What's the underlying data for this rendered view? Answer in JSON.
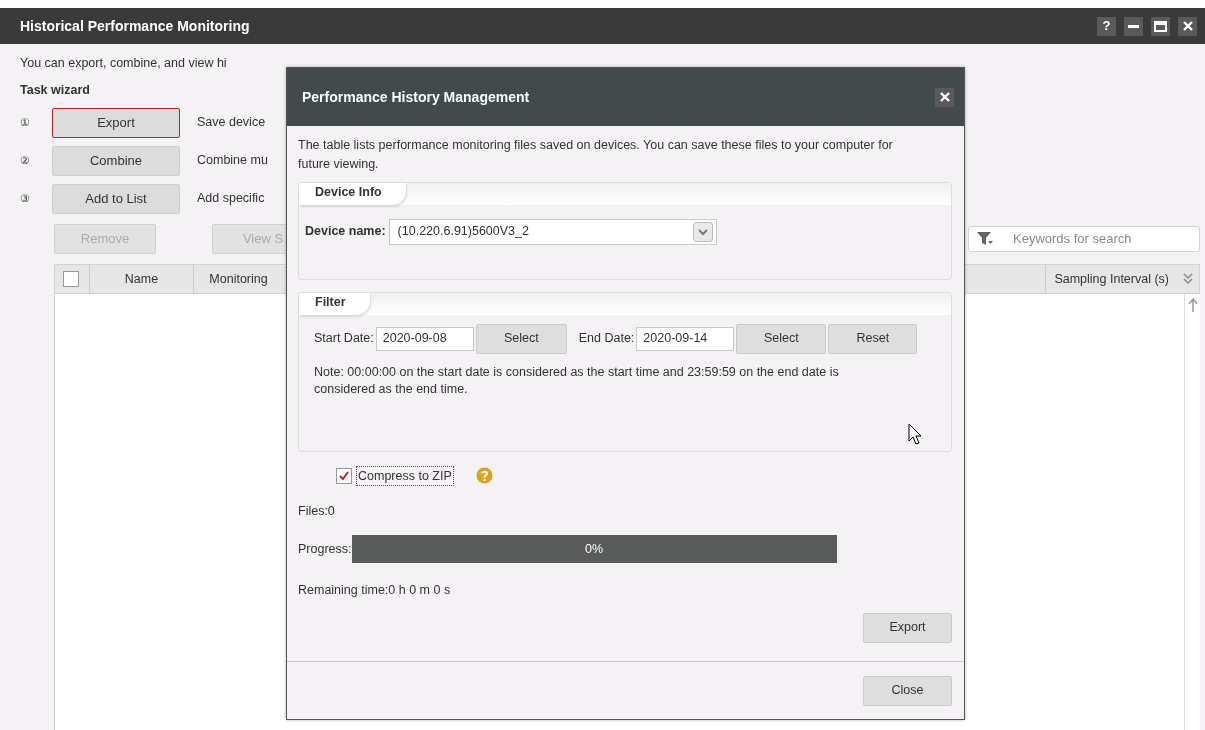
{
  "window": {
    "title": "Historical Performance Monitoring",
    "help": "?"
  },
  "main": {
    "intro": "You can export, combine, and view hi",
    "wizard_title": "Task wizard",
    "steps": [
      {
        "marker": "①",
        "button": "Export",
        "focused": true,
        "description": "Save device"
      },
      {
        "marker": "②",
        "button": "Combine",
        "focused": false,
        "description": "Combine mu"
      },
      {
        "marker": "③",
        "button": "Add to List",
        "focused": false,
        "description": "Add specific"
      }
    ],
    "actions": [
      {
        "label": "Remove",
        "disabled": true
      },
      {
        "label": "View S",
        "disabled": true
      }
    ],
    "search": {
      "placeholder": "Keywords for search"
    },
    "table": {
      "select_all": {
        "checked": false
      },
      "columns": [
        {
          "label": "Name"
        },
        {
          "label": "Monitoring"
        },
        {
          "label": "Sampling Interval (s)"
        }
      ]
    }
  },
  "dialog": {
    "title": "Performance History Management",
    "description": "The table lists performance monitoring files saved on devices. You can save these files to your computer for future viewing.",
    "device_info": {
      "legend": "Device Info",
      "label": "Device name:",
      "value": "(10.220.6.91)5600V3_2"
    },
    "filter": {
      "legend": "Filter",
      "start_label": "Start Date:",
      "start_value": "2020-09-08",
      "start_button": "Select",
      "end_label": "End Date:",
      "end_value": "2020-09-14",
      "end_button": "Select",
      "reset_button": "Reset",
      "note": "Note: 00:00:00 on the start date is considered as the start time and 23:59:59 on the end date is considered as the end time."
    },
    "compress": {
      "label": "Compress to ZIP",
      "checked": true
    },
    "files": "Files:0",
    "progress": {
      "label": "Progress:",
      "level": 0,
      "text": "0%"
    },
    "remaining": "Remaining time:0 h 0 m 0 s",
    "export_button": "Export",
    "close_button": "Close"
  }
}
